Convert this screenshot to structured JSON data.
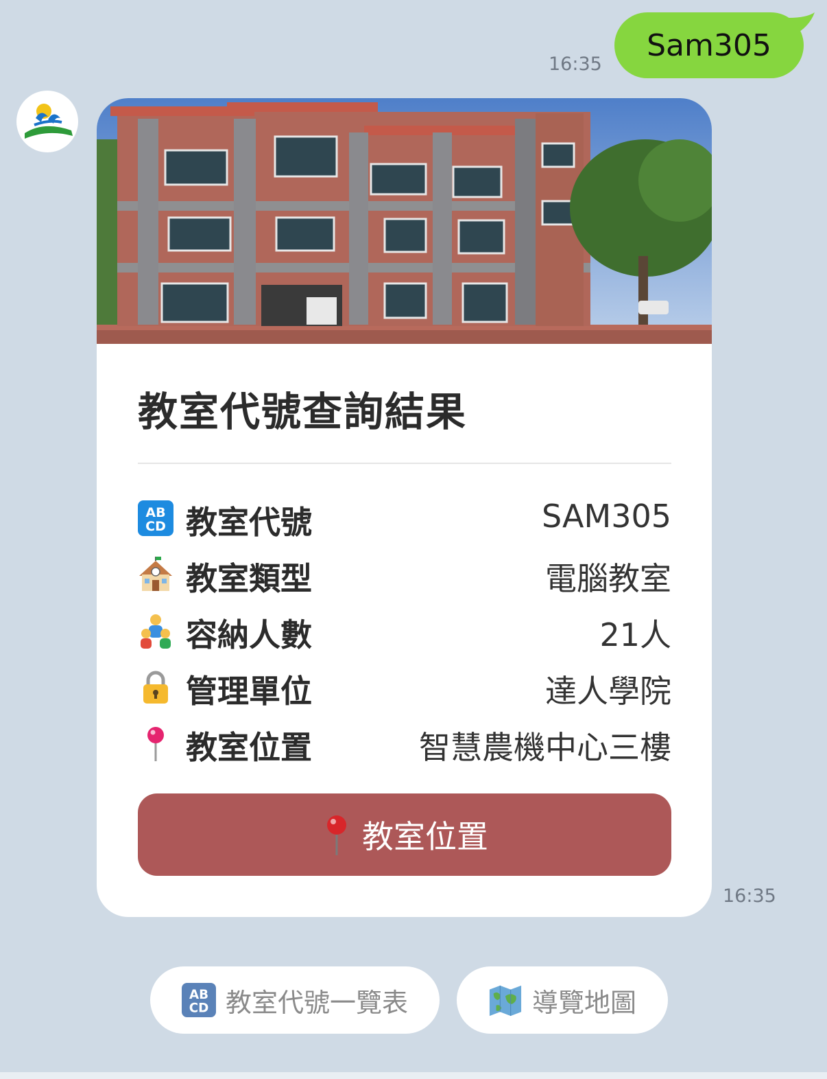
{
  "sent_message": {
    "text": "Sam305",
    "time": "16:35"
  },
  "bot": {
    "avatar_icon": "school-logo-icon"
  },
  "card": {
    "title": "教室代號查詢結果",
    "hero_image": "building-photo",
    "rows": [
      {
        "icon": "abcd-icon",
        "label": "教室代號",
        "value": "SAM305"
      },
      {
        "icon": "school-icon",
        "label": "教室類型",
        "value": "電腦教室"
      },
      {
        "icon": "family-icon",
        "label": "容納人數",
        "value": "21人"
      },
      {
        "icon": "lock-icon",
        "label": "管理單位",
        "value": "達人學院"
      },
      {
        "icon": "round-pushpin-icon",
        "label": "教室位置",
        "value": "智慧農機中心三樓"
      }
    ],
    "button": {
      "icon": "pushpin-icon",
      "label": "教室位置",
      "color": "#ad5858"
    },
    "time": "16:35"
  },
  "quick_replies": [
    {
      "icon": "abcd-icon",
      "label": "教室代號一覽表"
    },
    {
      "icon": "world-map-icon",
      "label": "導覽地圖"
    }
  ],
  "colors": {
    "background": "#cfdae5",
    "sent_bubble": "#86d63f",
    "button": "#ad5858"
  }
}
